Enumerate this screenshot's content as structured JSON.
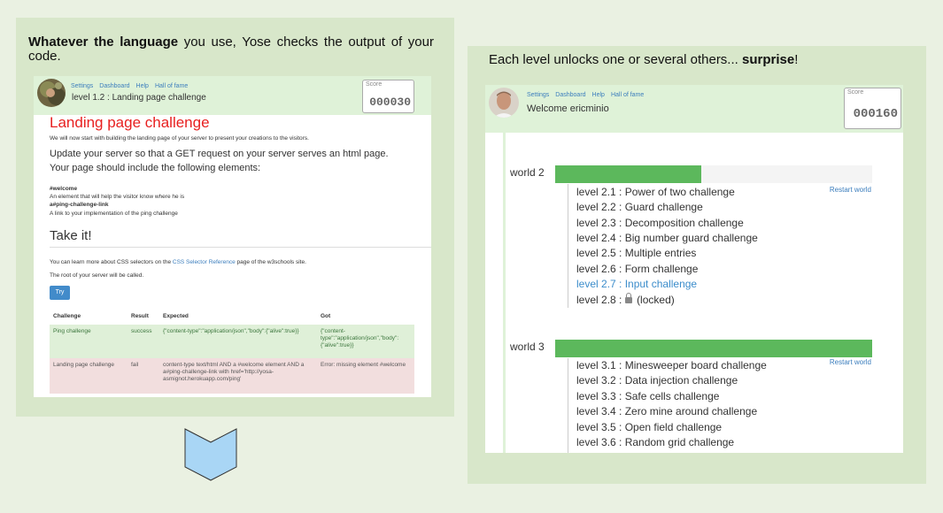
{
  "left_caption": {
    "bold": "Whatever the language",
    "rest": " you use, Yose checks the output of your code."
  },
  "right_caption": {
    "text": "Each level unlocks one or several others... ",
    "bold": "surprise",
    "tail": "!"
  },
  "nav": [
    "Settings",
    "Dashboard",
    "Help",
    "Hall of fame"
  ],
  "score_label": "Score",
  "left_shot": {
    "title": "level 1.2 : Landing page challenge",
    "score": "000030",
    "heading": "Landing page challenge",
    "intro": "We will now start with building the landing page of your server to present your creations to the visitors.",
    "task1": "Update your server so that a GET request on your server serves an html page.",
    "task2": "Your page should include the following elements:",
    "el1_name": "#welcome",
    "el1_desc": "An element that will help the visitor know where he is",
    "el2_name": "a#ping-challenge-link",
    "el2_desc": "A link to your implementation of the ping challenge",
    "take_it": "Take it!",
    "learn_pre": "You can learn more about CSS selectors on the ",
    "learn_link": "CSS Selector Reference",
    "learn_post": " page of the w3schools site.",
    "root": "The root of your server will be called.",
    "try_label": "Try",
    "table_headers": [
      "Challenge",
      "Result",
      "Expected",
      "Got"
    ],
    "rows": [
      {
        "challenge": "Ping challenge",
        "result": "success",
        "expected": "{\"content-type\":\"application/json\",\"body\":{\"alive\":true}}",
        "got": "{\"content-type\":\"application/json\",\"body\":{\"alive\":true}}"
      },
      {
        "challenge": "Landing page challenge",
        "result": "fail",
        "expected": "content-type text/html AND a #welcome element AND a a#ping-challenge-link with href='http://yosa-asmignot.herokuapp.com/ping'",
        "got": "Error: missing element #welcome"
      }
    ]
  },
  "right_shot": {
    "title": "Welcome ericminio",
    "score": "000160",
    "restart_label": "Restart world",
    "worlds": [
      {
        "label": "world 2",
        "progress": 0.46,
        "levels": [
          {
            "text": "level 2.1 : Power of two challenge",
            "state": "done"
          },
          {
            "text": "level 2.2 : Guard challenge",
            "state": "done"
          },
          {
            "text": "level 2.3 : Decomposition challenge",
            "state": "done"
          },
          {
            "text": "level 2.4 : Big number guard challenge",
            "state": "done"
          },
          {
            "text": "level 2.5 : Multiple entries",
            "state": "done"
          },
          {
            "text": "level 2.6 : Form challenge",
            "state": "done"
          },
          {
            "text": "level 2.7 : Input challenge",
            "state": "active"
          },
          {
            "text": "level 2.8 :",
            "suffix": "(locked)",
            "state": "locked"
          }
        ]
      },
      {
        "label": "world 3",
        "progress": 1.0,
        "levels": [
          {
            "text": "level 3.1 : Minesweeper board challenge",
            "state": "done"
          },
          {
            "text": "level 3.2 : Data injection challenge",
            "state": "done"
          },
          {
            "text": "level 3.3 : Safe cells challenge",
            "state": "done"
          },
          {
            "text": "level 3.4 : Zero mine around challenge",
            "state": "done"
          },
          {
            "text": "level 3.5 : Open field challenge",
            "state": "done"
          },
          {
            "text": "level 3.6 : Random grid challenge",
            "state": "done"
          }
        ]
      }
    ]
  },
  "colors": {
    "accent": "#5cb85c",
    "link": "#3c7ebd",
    "challenge_title": "#e82020",
    "header_bg": "#dff2d8",
    "arrow": "#a9d6f5"
  }
}
